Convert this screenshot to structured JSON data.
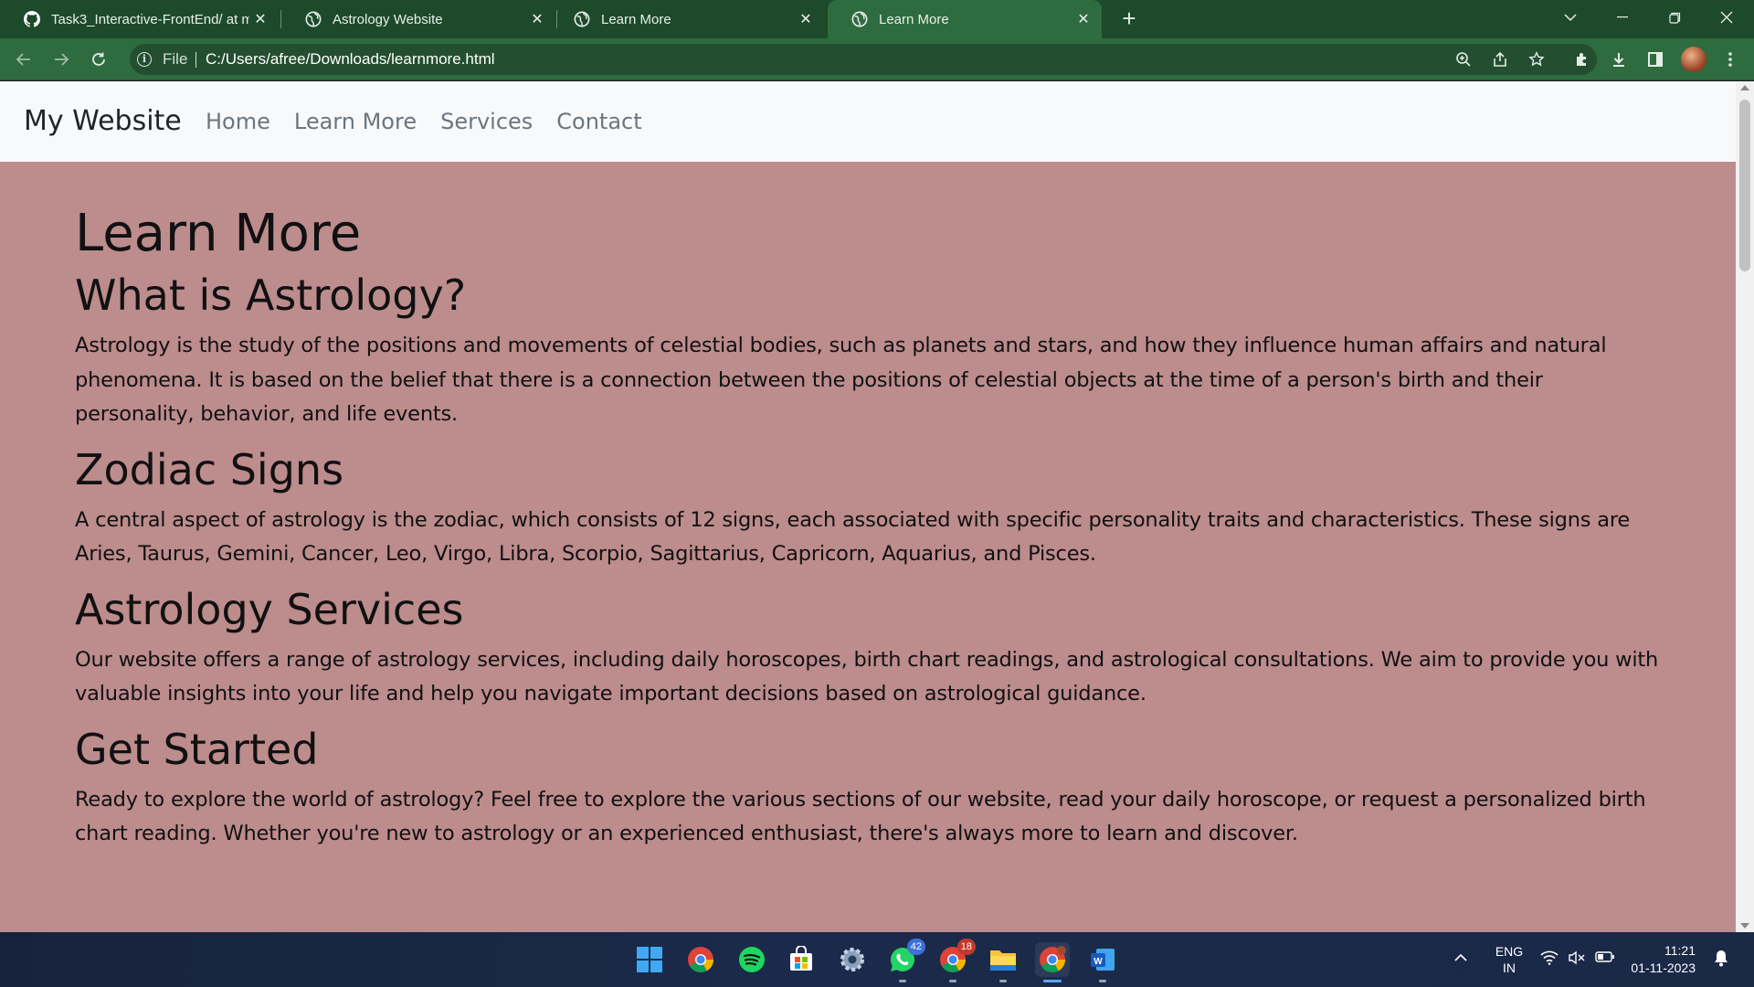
{
  "browser": {
    "tabs": [
      {
        "title": "Task3_Interactive-FrontEnd/ at m",
        "icon": "github-icon",
        "active": false
      },
      {
        "title": "Astrology Website",
        "icon": "globe-icon",
        "active": false
      },
      {
        "title": "Learn More",
        "icon": "globe-icon",
        "active": false
      },
      {
        "title": "Learn More",
        "icon": "globe-icon",
        "active": true
      }
    ],
    "address": {
      "scheme": "File",
      "url": "C:/Users/afree/Downloads/learnmore.html"
    }
  },
  "site": {
    "brand": "My Website",
    "nav": [
      "Home",
      "Learn More",
      "Services",
      "Contact"
    ],
    "background": "#bd8c8c"
  },
  "content": {
    "title": "Learn More",
    "sections": [
      {
        "heading": "What is Astrology?",
        "body": "Astrology is the study of the positions and movements of celestial bodies, such as planets and stars, and how they influence human affairs and natural phenomena. It is based on the belief that there is a connection between the positions of celestial objects at the time of a person's birth and their personality, behavior, and life events."
      },
      {
        "heading": "Zodiac Signs",
        "body": "A central aspect of astrology is the zodiac, which consists of 12 signs, each associated with specific personality traits and characteristics. These signs are Aries, Taurus, Gemini, Cancer, Leo, Virgo, Libra, Scorpio, Sagittarius, Capricorn, Aquarius, and Pisces."
      },
      {
        "heading": "Astrology Services",
        "body": "Our website offers a range of astrology services, including daily horoscopes, birth chart readings, and astrological consultations. We aim to provide you with valuable insights into your life and help you navigate important decisions based on astrological guidance."
      },
      {
        "heading": "Get Started",
        "body": "Ready to explore the world of astrology? Feel free to explore the various sections of our website, read your daily horoscope, or request a personalized birth chart reading. Whether you're new to astrology or an experienced enthusiast, there's always more to learn and discover."
      }
    ]
  },
  "taskbar": {
    "apps": [
      {
        "name": "windows-start-icon"
      },
      {
        "name": "chrome-icon"
      },
      {
        "name": "spotify-icon"
      },
      {
        "name": "microsoft-store-icon"
      },
      {
        "name": "settings-icon"
      },
      {
        "name": "whatsapp-icon",
        "badge": "42"
      },
      {
        "name": "chrome-profile-icon",
        "badge": "18"
      },
      {
        "name": "file-explorer-icon"
      },
      {
        "name": "chrome-active-icon"
      },
      {
        "name": "word-icon"
      }
    ],
    "language": {
      "line1": "ENG",
      "line2": "IN"
    },
    "time": "11:21",
    "date": "01-11-2023"
  }
}
